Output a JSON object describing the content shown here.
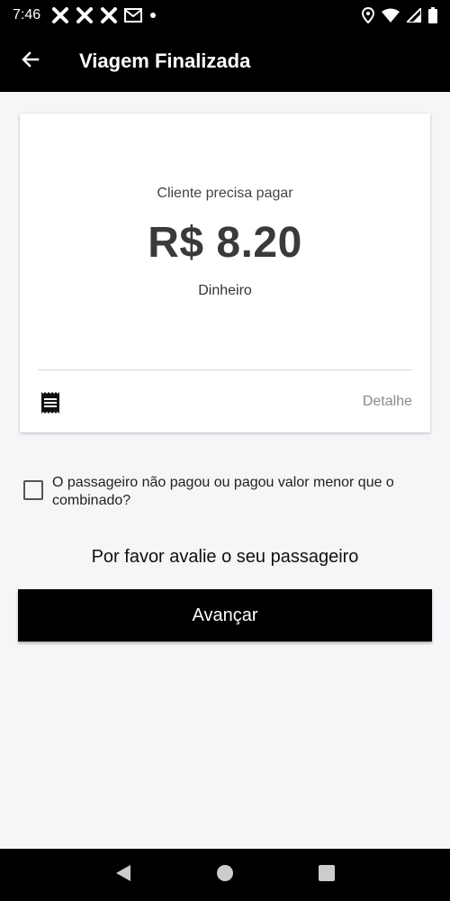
{
  "status_bar": {
    "time": "7:46",
    "icons_left": [
      "notification-x-icon",
      "notification-x-icon",
      "notification-x-icon",
      "gmail-icon",
      "dot-icon"
    ],
    "icons_right": [
      "location-icon",
      "wifi-icon",
      "signal-icon",
      "battery-icon"
    ]
  },
  "app_bar": {
    "title": "Viagem Finalizada",
    "back_icon": "arrow-left-icon"
  },
  "card": {
    "subtitle": "Cliente precisa pagar",
    "amount": "R$ 8.20",
    "payment_method": "Dinheiro",
    "receipt_icon": "receipt-icon",
    "detail_label": "Detalhe"
  },
  "checkbox": {
    "label": "O passageiro não pagou ou pagou valor menor que o combinado?",
    "checked": false
  },
  "rate_prompt": "Por favor avalie o seu passageiro",
  "advance_button": "Avançar",
  "colors": {
    "bar_background": "#000000",
    "page_background": "#f7f5f8",
    "card_background": "#ffffff",
    "amount_text": "#3a3a3a",
    "detail_text": "#8a8a8a"
  }
}
